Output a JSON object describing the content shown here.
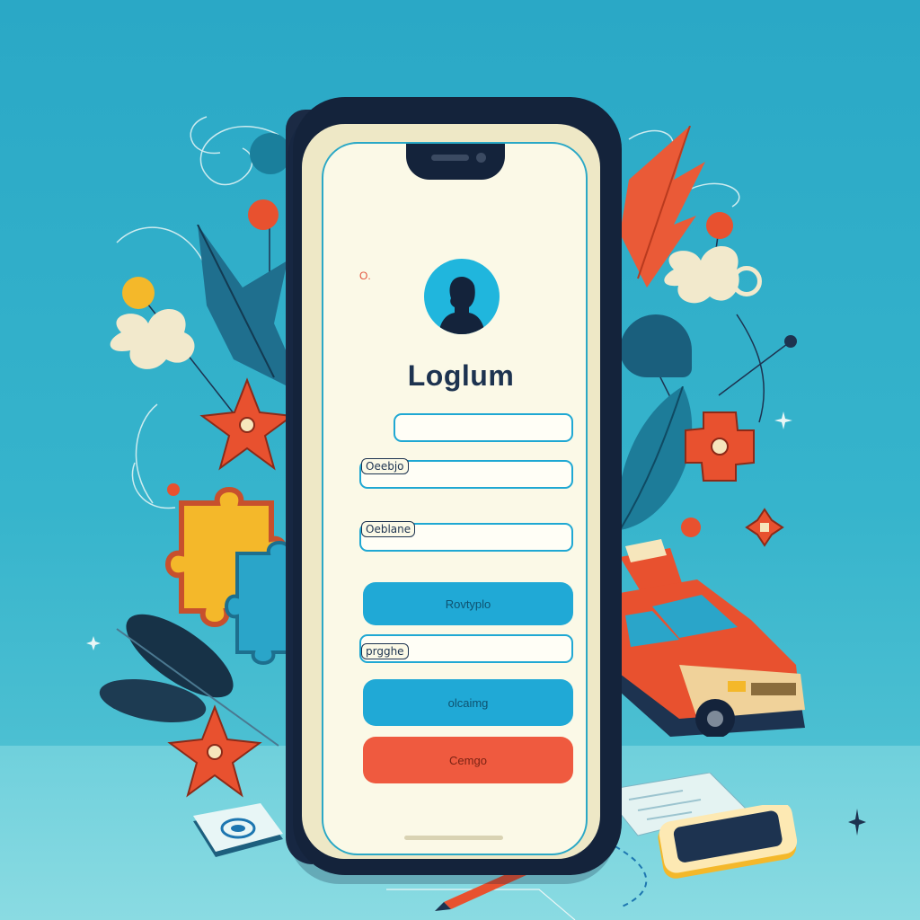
{
  "screen": {
    "corner_mark": "O.",
    "title": "Loglum",
    "fields": [
      {
        "label": "Oeebjo"
      },
      {
        "label": "Oeblane"
      },
      {
        "label": "prgghe"
      }
    ],
    "buttons": [
      {
        "label": "Rovtyplo"
      },
      {
        "label": "olcaimg"
      },
      {
        "label": "Cemgo"
      }
    ]
  },
  "colors": {
    "background": "#2aa8c6",
    "accent": "#20a9d6",
    "danger": "#ef5a3f",
    "screen": "#fbf9e7",
    "phone": "#14233b"
  },
  "icons": [
    "avatar-silhouette-icon",
    "flower-icon",
    "puzzle-piece-icon",
    "leaf-icon",
    "car-icon",
    "pencil-icon",
    "smartphone-icon",
    "sparkle-icon"
  ]
}
